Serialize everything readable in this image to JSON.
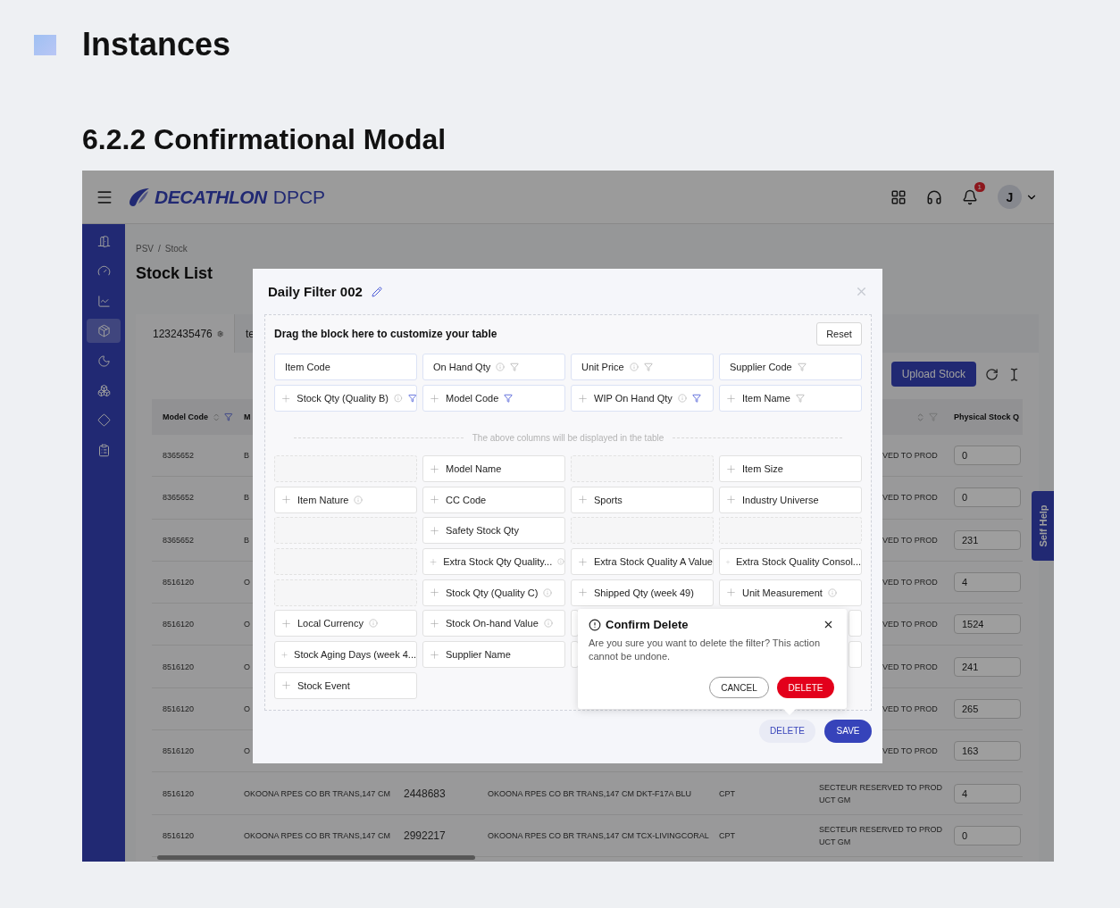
{
  "page": {
    "title": "Instances",
    "subtitle": "6.2.2 Confirmational Modal"
  },
  "app": {
    "topbar": {
      "brand": "DECATHLON",
      "product": "DPCP",
      "notification_count": "1",
      "avatar_initial": "J"
    },
    "sidebar": {
      "items": [
        {
          "selected": false
        },
        {
          "selected": false
        },
        {
          "selected": false
        },
        {
          "selected": true
        },
        {
          "selected": false
        },
        {
          "selected": false
        },
        {
          "selected": false
        },
        {
          "selected": false
        }
      ]
    },
    "breadcrumb": [
      "PSV",
      "/",
      "Stock"
    ],
    "heading": "Stock List",
    "tabs": [
      {
        "label": "1232435476",
        "selected": true
      },
      {
        "label": "te",
        "selected": false
      }
    ],
    "upload_button": "Upload Stock",
    "table": {
      "header": {
        "model_code": {
          "label": "Model Code",
          "sortable": true,
          "filter": true,
          "filter_active": true
        },
        "column_2": {
          "label": "M"
        },
        "status": {
          "sortable": true,
          "filter": true,
          "filter_active": false
        },
        "physical_stock": {
          "label": "Physical Stock Q"
        }
      },
      "rows": [
        {
          "model_code": "8365652",
          "column_2": "B",
          "status_fragment": "VED TO PROD",
          "physical_stock": "0"
        },
        {
          "model_code": "8365652",
          "column_2": "B",
          "status_fragment": "VED TO PROD",
          "physical_stock": "0"
        },
        {
          "model_code": "8365652",
          "column_2": "B",
          "status_fragment": "VED TO PROD",
          "physical_stock": "231"
        },
        {
          "model_code": "8516120",
          "column_2": "O",
          "status_fragment": "VED TO PROD",
          "physical_stock": "4"
        },
        {
          "model_code": "8516120",
          "column_2": "O",
          "status_fragment": "VED TO PROD",
          "physical_stock": "1524"
        },
        {
          "model_code": "8516120",
          "column_2": "O",
          "status_fragment": "VED TO PROD",
          "physical_stock": "241"
        },
        {
          "model_code": "8516120",
          "column_2": "O",
          "status_fragment": "VED TO PROD",
          "physical_stock": "265"
        },
        {
          "model_code": "8516120",
          "column_2": "O",
          "status_fragment": "VED TO PROD",
          "physical_stock": "163"
        },
        {
          "model_code": "8516120",
          "column_2": "OKOONA RPES CO BR TRANS,147 CM",
          "column_3": "2448683",
          "column_4": "OKOONA RPES CO BR TRANS,147 CM DKT-F17A BLU",
          "column_5": "CPT",
          "status": "SECTEUR RESERVED TO PROD UCT GM",
          "physical_stock": "4"
        },
        {
          "model_code": "8516120",
          "column_2": "OKOONA RPES CO BR TRANS,147 CM",
          "column_3": "2992217",
          "column_4": "OKOONA RPES CO BR TRANS,147 CM TCX-LIVINGCORAL",
          "column_5": "CPT",
          "status": "SECTEUR RESERVED TO PROD UCT GM",
          "physical_stock": "0"
        }
      ]
    },
    "self_help": "Self Help"
  },
  "modal": {
    "title": "Daily Filter 002",
    "section_title": "Drag the block here to customize your table",
    "reset_button": "Reset",
    "selected_blocks": [
      {
        "kind": "block",
        "label": "Item Code",
        "draggable": false,
        "info": false,
        "filter": false
      },
      {
        "kind": "block",
        "label": "On Hand Qty",
        "draggable": false,
        "info": true,
        "filter": true,
        "filter_active": false
      },
      {
        "kind": "block",
        "label": "Unit Price",
        "draggable": false,
        "info": true,
        "filter": true,
        "filter_active": false
      },
      {
        "kind": "block",
        "label": "Supplier Code",
        "draggable": false,
        "info": false,
        "filter": true,
        "filter_active": false
      },
      {
        "kind": "block",
        "label": "Stock Qty (Quality B)",
        "draggable": true,
        "info": true,
        "filter": true,
        "filter_active": true
      },
      {
        "kind": "block",
        "label": "Model Code",
        "draggable": true,
        "info": false,
        "filter": true,
        "filter_active": true
      },
      {
        "kind": "block",
        "label": "WIP On Hand Qty",
        "draggable": true,
        "info": true,
        "filter": true,
        "filter_active": true
      },
      {
        "kind": "block",
        "label": "Item Name",
        "draggable": true,
        "info": false,
        "filter": true,
        "filter_active": false
      }
    ],
    "divider_text": "The above columns will be displayed in the table",
    "available_blocks": [
      {
        "kind": "slot"
      },
      {
        "kind": "block",
        "label": "Model Name",
        "info": false
      },
      {
        "kind": "slot"
      },
      {
        "kind": "block",
        "label": "Item Size",
        "info": false
      },
      {
        "kind": "block",
        "label": "Item Nature",
        "info": true
      },
      {
        "kind": "block",
        "label": "CC Code",
        "info": false
      },
      {
        "kind": "block",
        "label": "Sports",
        "info": false
      },
      {
        "kind": "block",
        "label": "Industry Universe",
        "info": false
      },
      {
        "kind": "slot"
      },
      {
        "kind": "block",
        "label": "Safety Stock Qty",
        "info": false
      },
      {
        "kind": "slot"
      },
      {
        "kind": "slot"
      },
      {
        "kind": "slot"
      },
      {
        "kind": "block",
        "label": "Extra Stock Qty Quality...",
        "info": true
      },
      {
        "kind": "block",
        "label": "Extra Stock Quality A Value",
        "info": false
      },
      {
        "kind": "block",
        "label": "Extra Stock Quality Consol...",
        "info": false
      },
      {
        "kind": "slot"
      },
      {
        "kind": "block",
        "label": "Stock Qty (Quality C)",
        "info": true
      },
      {
        "kind": "block",
        "label": "Shipped Qty (week 49)",
        "info": false
      },
      {
        "kind": "block",
        "label": "Unit Measurement",
        "info": true
      },
      {
        "kind": "block",
        "label": "Local Currency",
        "info": true
      },
      {
        "kind": "block",
        "label": "Stock On-hand Value",
        "info": true
      },
      {
        "kind": "block"
      },
      {
        "kind": "block"
      },
      {
        "kind": "block",
        "label": "Stock Aging Days (week 4...",
        "info": false
      },
      {
        "kind": "block",
        "label": "Supplier Name",
        "info": false
      },
      {
        "kind": "block"
      },
      {
        "kind": "block"
      },
      {
        "kind": "block",
        "label": "Stock Event",
        "info": false
      }
    ],
    "delete_button": "DELETE",
    "save_button": "SAVE",
    "confirm": {
      "title": "Confirm Delete",
      "message": "Are you sure you want to delete the filter? This action cannot be undone.",
      "cancel_button": "CANCEL",
      "delete_button": "DELETE"
    }
  }
}
